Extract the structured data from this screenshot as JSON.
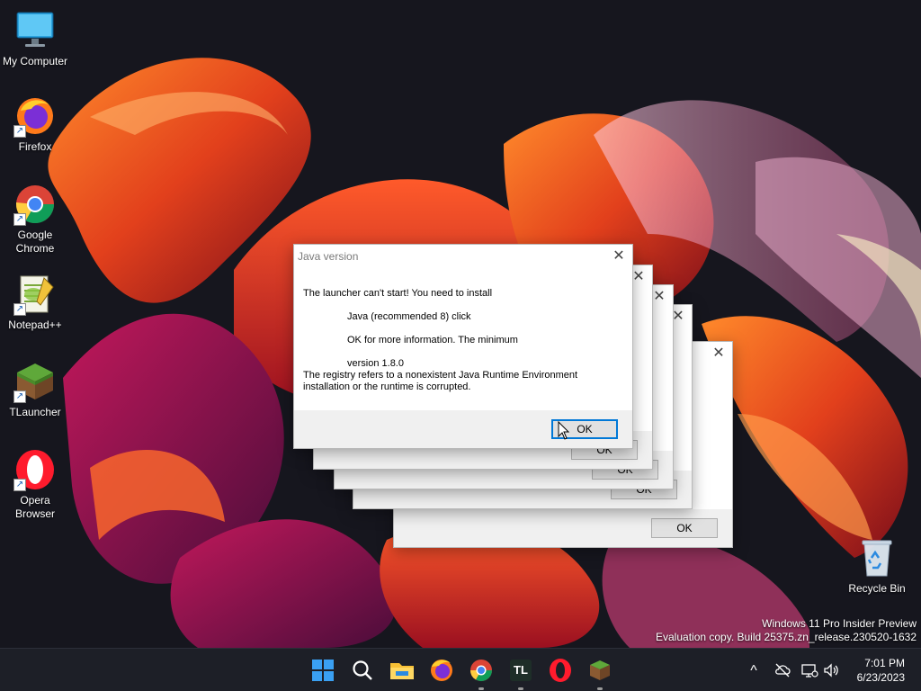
{
  "desktop": {
    "icons": [
      {
        "label": "My Computer"
      },
      {
        "label": "Firefox"
      },
      {
        "label": "Google Chrome"
      },
      {
        "label": "Notepad++"
      },
      {
        "label": "TLauncher"
      },
      {
        "label": "Opera Browser"
      },
      {
        "label": "Recycle Bin"
      }
    ],
    "watermark": {
      "line1": "Windows 11 Pro Insider Preview",
      "line2": "Evaluation copy. Build 25375.zn_release.230520-1632"
    }
  },
  "dialog": {
    "title": "Java version",
    "line1": "The launcher can't start! You need to install",
    "line2": "Java (recommended 8) click",
    "line3": "OK for more information. The minimum",
    "line4": "version 1.8.0",
    "line5": "The registry refers to a nonexistent Java Runtime Environment",
    "line6": "installation or the runtime is corrupted.",
    "ok_label": "OK",
    "close_glyph": "✕"
  },
  "stacked_dialogs": [
    {
      "ok_label": "OK"
    },
    {
      "ok_label": "OK"
    },
    {
      "ok_label": "OK"
    },
    {
      "ok_label": "OK"
    }
  ],
  "taskbar": {
    "pinned": [
      "start-icon",
      "search-icon",
      "file-explorer-icon",
      "firefox-icon",
      "chrome-icon",
      "tlauncher-icon",
      "opera-icon",
      "minecraft-icon"
    ],
    "tlauncher_text": "TL",
    "tray": {
      "chevron": "^"
    },
    "clock": {
      "time": "7:01 PM",
      "date": "6/23/2023"
    }
  },
  "colors": {
    "accent": "#0078d7",
    "taskbar": "#1d1f27"
  }
}
